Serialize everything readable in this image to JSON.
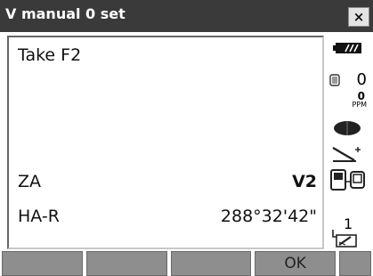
{
  "window": {
    "title": "V manual 0 set",
    "close_label": "×"
  },
  "main": {
    "message": "Take F2",
    "rows": [
      {
        "label": "ZA",
        "value": "V2"
      },
      {
        "label": "HA-R",
        "value": "288°32'42\""
      }
    ]
  },
  "status": {
    "battery": "battery-icon",
    "sd_count": "0",
    "ppm_value": "0",
    "ppm_label": "PPM",
    "prism_icon": "prism-icon",
    "tilt_icon": "tilt-icon",
    "connection_icon": "bluetooth-device-icon",
    "page_number": "1",
    "input_mode_icon": "keyboard-input-icon"
  },
  "softkeys": [
    "",
    "",
    "",
    "OK",
    ""
  ]
}
